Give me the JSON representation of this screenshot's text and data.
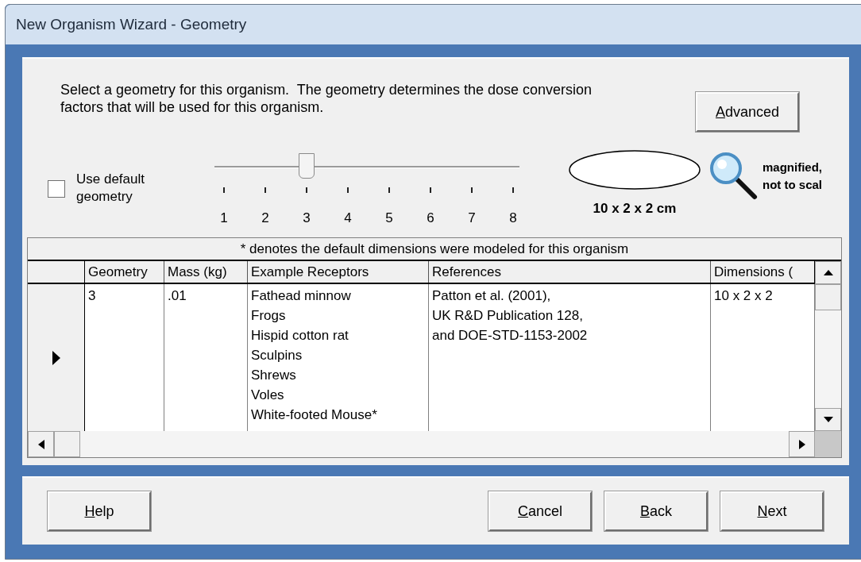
{
  "window": {
    "title": "New Organism Wizard - Geometry"
  },
  "instructions": "Select a geometry for this organism.  The geometry determines the dose conversion factors that will be used for this organism.",
  "advanced_button": {
    "label": "Advanced",
    "underline_first": true
  },
  "default_checkbox": {
    "label": "Use default geometry",
    "checked": false
  },
  "slider": {
    "level": 0.286,
    "ticks": [
      "1",
      "2",
      "3",
      "4",
      "5",
      "6",
      "7",
      "8"
    ]
  },
  "shape_preview": {
    "size": "10 x 2 x 2 cm"
  },
  "scale_note": "magnified, not to scal",
  "grid": {
    "caption": "* denotes the default dimensions were modeled for this organism",
    "columns": [
      "Geometry",
      "Mass (kg)",
      "Example Receptors",
      "References",
      "Dimensions ("
    ],
    "rows": [
      {
        "selected": true,
        "cells": [
          [
            "3"
          ],
          [
            ".01"
          ],
          [
            "Fathead minnow",
            "Frogs",
            "Hispid cotton rat",
            "Sculpins",
            "Shrews",
            "Voles",
            "White-footed Mouse*"
          ],
          [
            "Patton et al. (2001),",
            "UK R&D Publication 128,",
            "and DOE-STD-1153-2002"
          ],
          [
            "10 x 2 x 2"
          ]
        ]
      }
    ]
  },
  "help_button": {
    "label": "Help",
    "underline_first": true
  },
  "nav_buttons": [
    {
      "label": "Cancel",
      "underline_first": true
    },
    {
      "label": "Back",
      "underline_first": true
    },
    {
      "label": "Next",
      "underline_first": true
    }
  ]
}
